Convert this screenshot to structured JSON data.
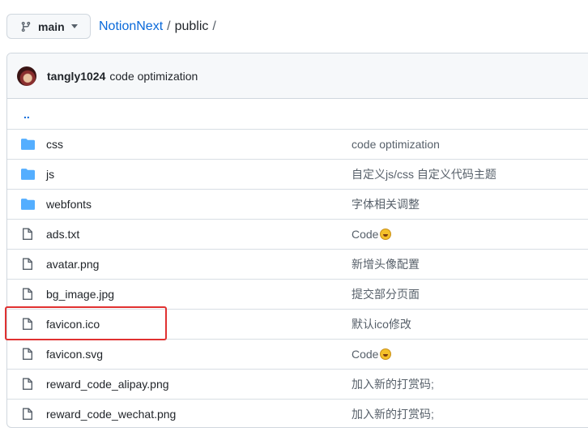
{
  "branch": {
    "label": "main",
    "icon": "git-branch-icon"
  },
  "breadcrumb": {
    "repo": "NotionNext",
    "separator": "/",
    "dir": "public",
    "trailing_sep": "/"
  },
  "commit": {
    "author": "tangly1024",
    "message": "code optimization"
  },
  "parent_link": "..",
  "files": [
    {
      "type": "folder",
      "name": "css",
      "message": "code optimization",
      "emoji": false
    },
    {
      "type": "folder",
      "name": "js",
      "message": "自定义js/css 自定义代码主题",
      "emoji": false
    },
    {
      "type": "folder",
      "name": "webfonts",
      "message": "字体相关调整",
      "emoji": false
    },
    {
      "type": "file",
      "name": "ads.txt",
      "message": "Code",
      "emoji": true
    },
    {
      "type": "file",
      "name": "avatar.png",
      "message": "新增头像配置",
      "emoji": false
    },
    {
      "type": "file",
      "name": "bg_image.jpg",
      "message": "提交部分页面",
      "emoji": false
    },
    {
      "type": "file",
      "name": "favicon.ico",
      "message": "默认ico修改",
      "emoji": false
    },
    {
      "type": "file",
      "name": "favicon.svg",
      "message": "Code",
      "emoji": true
    },
    {
      "type": "file",
      "name": "reward_code_alipay.png",
      "message": "加入新的打赏码;",
      "emoji": false
    },
    {
      "type": "file",
      "name": "reward_code_wechat.png",
      "message": "加入新的打赏码;",
      "emoji": false
    }
  ],
  "colors": {
    "link": "#0969da",
    "folder": "#54aeff",
    "highlight": "#e03131"
  }
}
